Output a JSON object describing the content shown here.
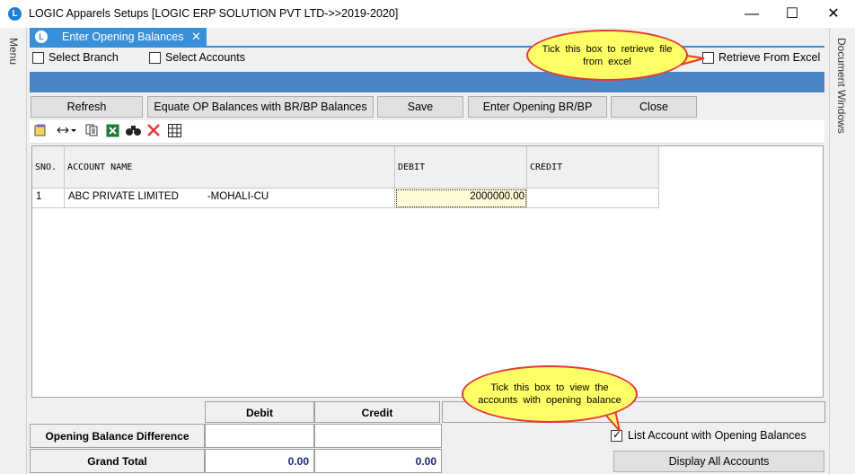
{
  "window": {
    "title": "LOGIC Apparels Setups  [LOGIC ERP SOLUTION PVT LTD->>2019-2020]",
    "icon_letter": "L",
    "minimize": "—",
    "maximize": "☐",
    "close": "✕"
  },
  "side": {
    "left_label": "Menu",
    "right_label": "Document Windows"
  },
  "tab": {
    "label": "Enter Opening Balances",
    "close": "✕",
    "icon_letter": "L"
  },
  "options": {
    "select_branch": "Select Branch",
    "select_accounts": "Select Accounts",
    "retrieve_from_excel": "Retrieve From Excel"
  },
  "buttons": {
    "refresh": "Refresh",
    "equate": "Equate OP Balances with BR/BP Balances",
    "save": "Save",
    "enter_opening": "Enter Opening BR/BP",
    "close": "Close"
  },
  "toolbar_icons": [
    "notes-icon",
    "column-resize-icon",
    "copy-icon",
    "excel-icon",
    "binoculars-icon",
    "delete-icon",
    "grid-icon"
  ],
  "grid": {
    "columns": [
      "SNO.",
      "ACCOUNT NAME",
      "DEBIT",
      "CREDIT"
    ],
    "rows": [
      {
        "sno": "1",
        "account": "ABC PRIVATE LIMITED          -MOHALI-CU",
        "debit": "2000000.00",
        "credit": ""
      }
    ]
  },
  "footer": {
    "debit_header": "Debit",
    "credit_header": "Credit",
    "diff_label": "Opening Balance Difference",
    "diff_debit": "",
    "diff_credit": "",
    "grand_label": "Grand Total",
    "grand_debit": "0.00",
    "grand_credit": "0.00",
    "list_with_balances": "List Account with Opening Balances",
    "display_all": "Display All Accounts"
  },
  "callouts": {
    "top": "Tick this box to retrieve file from excel",
    "bottom": "Tick this box to view the accounts with opening balance"
  },
  "state": {
    "list_with_balances_checked": true,
    "retrieve_from_excel_checked": false
  },
  "colors": {
    "accent": "#3a8fd9",
    "bar": "#4a86c5",
    "callout_fill": "#ffff66",
    "callout_border": "#e53935",
    "total_text": "#1a237e"
  }
}
